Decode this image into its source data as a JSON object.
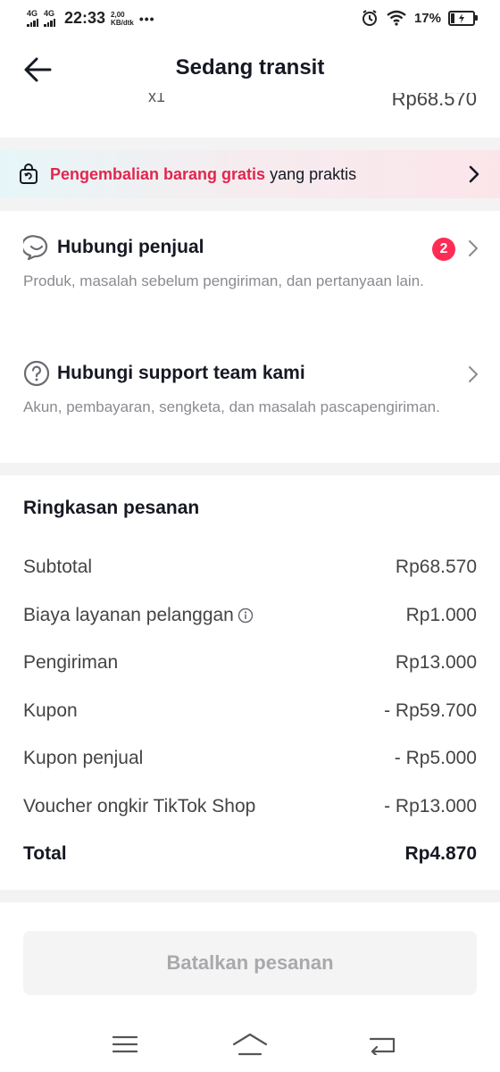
{
  "status_bar": {
    "net1": "4G",
    "net2": "4G",
    "time": "22:33",
    "speed_value": "2,00",
    "speed_unit": "KB/dtk",
    "dots": "•••",
    "battery_text": "17%",
    "battery_level": 0.17
  },
  "header": {
    "title": "Sedang transit",
    "back_icon": "arrow-left-icon"
  },
  "partial_item": {
    "qty": "x1",
    "price": "Rp68.570"
  },
  "return_banner": {
    "highlight": "Pengembalian barang gratis",
    "rest": " yang praktis",
    "accent_color": "#e2264d"
  },
  "contact_seller": {
    "title": "Hubungi penjual",
    "description": "Produk, masalah sebelum pengiriman, dan pertanyaan lain.",
    "badge": "2",
    "icon": "chat-bubble-icon"
  },
  "contact_support": {
    "title": "Hubungi support team kami",
    "description": "Akun, pembayaran, sengketa, dan masalah pascapengiriman.",
    "icon": "question-circle-icon"
  },
  "summary": {
    "title": "Ringkasan pesanan",
    "rows": [
      {
        "label": "Subtotal",
        "value": "Rp68.570"
      },
      {
        "label": "Biaya layanan pelanggan",
        "value": "Rp1.000"
      },
      {
        "label": "Pengiriman",
        "value": "Rp13.000"
      },
      {
        "label": "Kupon",
        "value": "- Rp59.700"
      },
      {
        "label": "Kupon penjual",
        "value": "- Rp5.000"
      },
      {
        "label": "Voucher ongkir TikTok Shop",
        "value": "- Rp13.000"
      }
    ],
    "total_label": "Total",
    "total_value": "Rp4.870"
  },
  "cancel_button": {
    "label": "Batalkan pesanan"
  },
  "nav": {
    "menu_icon": "menu-icon",
    "home_icon": "home-icon",
    "back_icon": "back-icon"
  }
}
